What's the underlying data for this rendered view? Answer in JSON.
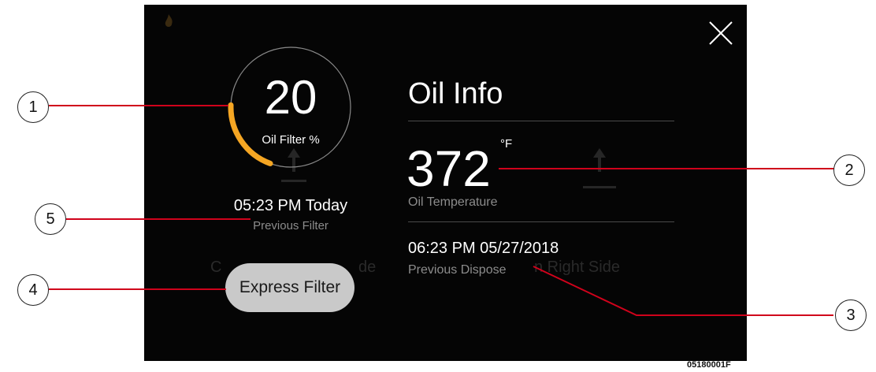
{
  "gauge": {
    "value": "20",
    "label": "Oil Filter %",
    "percent": 20,
    "arc_color": "#f5a623"
  },
  "previous_filter": {
    "time": "05:23 PM Today",
    "label": "Previous Filter"
  },
  "express_filter_label": "Express Filter",
  "oil_info": {
    "title": "Oil Info",
    "temperature": "372",
    "unit": "°F",
    "temperature_label": "Oil Temperature",
    "dispose_time": "06:23 PM 05/27/2018",
    "dispose_label": "Previous Dispose"
  },
  "icons": {
    "close": "close-icon",
    "flame": "flame-icon"
  },
  "callouts": [
    "1",
    "2",
    "3",
    "4",
    "5"
  ],
  "figure_code": "05180001F",
  "colors": {
    "screen_bg": "#050505",
    "leader_line": "#d0021b",
    "accent": "#f5a623"
  }
}
